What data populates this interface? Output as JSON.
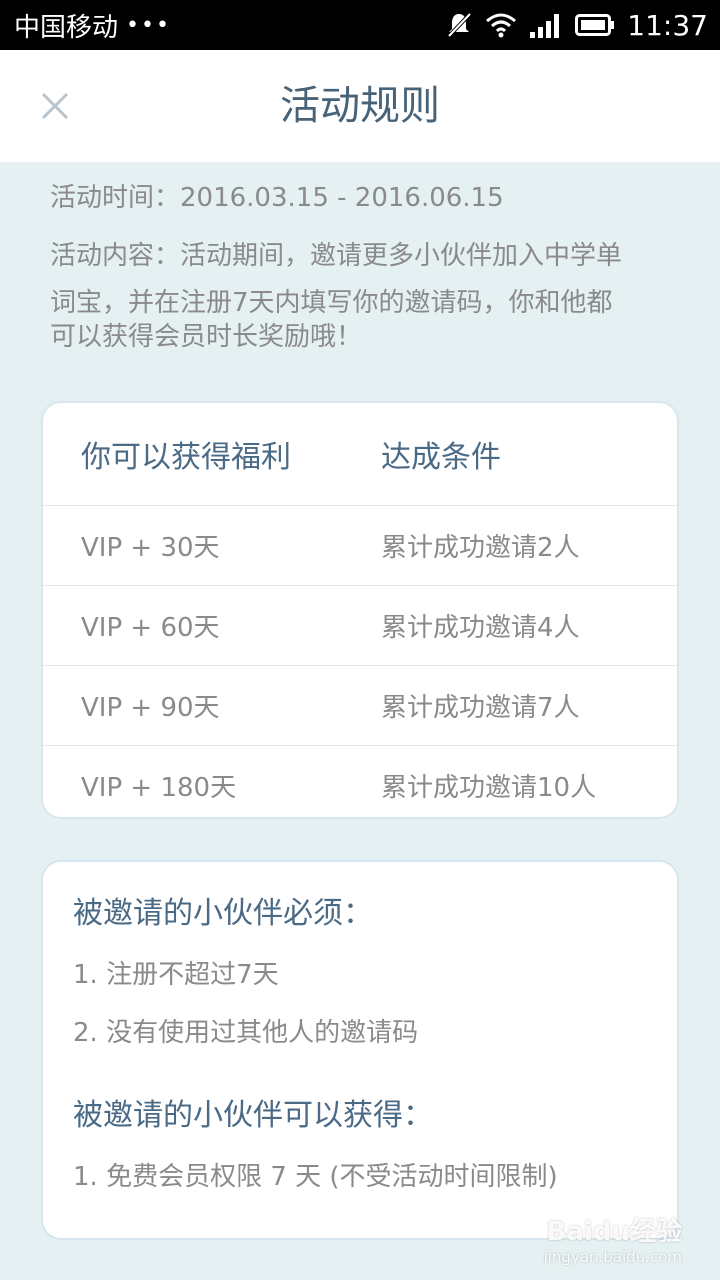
{
  "status_bar": {
    "carrier": "中国移动",
    "dots": "•••",
    "time": "11:37",
    "icons": [
      "mute-icon",
      "wifi-icon",
      "signal-icon",
      "battery-icon"
    ]
  },
  "header": {
    "title": "活动规则",
    "close_icon": "close-icon"
  },
  "info": {
    "time_line": "活动时间：2016.03.15 - 2016.06.15",
    "content_line1": "活动内容：活动期间，邀请更多小伙伴加入中学单",
    "content_line2": "词宝，并在注册7天内填写你的邀请码，你和他都",
    "content_line3": "可以获得会员时长奖励哦！"
  },
  "rewards_table": {
    "headers": [
      "你可以获得福利",
      "达成条件"
    ],
    "rows": [
      [
        "VIP + 30天",
        "累计成功邀请2人"
      ],
      [
        "VIP + 60天",
        "累计成功邀请4人"
      ],
      [
        "VIP + 90天",
        "累计成功邀请7人"
      ],
      [
        "VIP + 180天",
        "累计成功邀请10人"
      ]
    ]
  },
  "requirements": {
    "must_heading": "被邀请的小伙伴必须：",
    "must_items": [
      "1. 注册不超过7天",
      "2. 没有使用过其他人的邀请码"
    ],
    "get_heading": "被邀请的小伙伴可以获得：",
    "get_items": [
      "1. 免费会员权限 7 天 (不受活动时间限制)"
    ]
  },
  "watermark": {
    "logo": "Baidu经验",
    "url": "jingyan.baidu.com"
  },
  "colors": {
    "background": "#e5f0f3",
    "title": "#486278",
    "heading": "#4a6a86",
    "body_text": "#8a8a8a"
  }
}
